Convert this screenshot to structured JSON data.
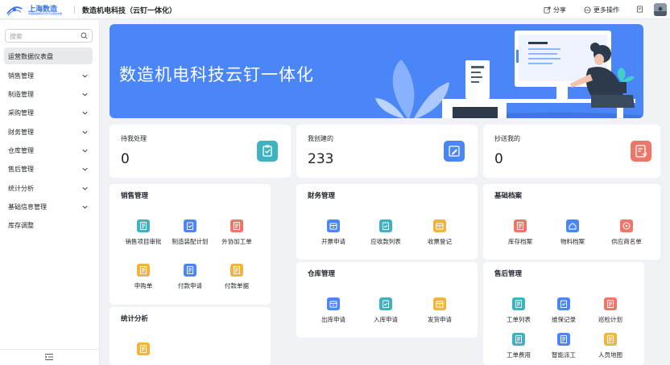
{
  "colors": {
    "blue": "#4a86f7",
    "teal": "#3fb2c2",
    "orange": "#f0b440",
    "red": "#ee7667",
    "banner": "#4a86f7"
  },
  "logo": {
    "name": "上海数造",
    "sub": "中國動機轉中化雲釘化數據產業",
    "icon": "logo-icon"
  },
  "app_title": "数造机电科技（云钉一体化）",
  "toolbar": {
    "share": "分享",
    "more": "更多操作"
  },
  "search": {
    "placeholder": "搜索"
  },
  "sidebar": {
    "items": [
      {
        "label": "运营数据仪表盘"
      },
      {
        "label": "销售管理"
      },
      {
        "label": "制造管理"
      },
      {
        "label": "采购管理"
      },
      {
        "label": "财务管理"
      },
      {
        "label": "仓库管理"
      },
      {
        "label": "售后管理"
      },
      {
        "label": "统计分析"
      },
      {
        "label": "基础信息管理"
      },
      {
        "label": "库存调整"
      }
    ]
  },
  "banner": {
    "title": "数造机电科技云钉一体化"
  },
  "stats": [
    {
      "label": "待我处理",
      "value": "0",
      "color": "#3fb2c2",
      "icon": "task-icon"
    },
    {
      "label": "我创建的",
      "value": "233",
      "color": "#4a86f7",
      "icon": "edit-icon"
    },
    {
      "label": "抄送我的",
      "value": "0",
      "color": "#ee7667",
      "icon": "cc-icon"
    }
  ],
  "cards": {
    "sales": {
      "title": "销售管理",
      "items": [
        {
          "label": "销售项目审批",
          "color": "#3fb2c2"
        },
        {
          "label": "制造装配计划",
          "color": "#4a86f7"
        },
        {
          "label": "外协加工单",
          "color": "#ee7667"
        },
        {
          "label": "申购单",
          "color": "#f0b440"
        },
        {
          "label": "付款申请",
          "color": "#4a86f7"
        },
        {
          "label": "付款单据",
          "color": "#f0b440"
        }
      ]
    },
    "finance": {
      "title": "财务管理",
      "items": [
        {
          "label": "开票申请",
          "color": "#4a86f7"
        },
        {
          "label": "应收款列表",
          "color": "#3fb2c2"
        },
        {
          "label": "收票登记",
          "color": "#f0b440"
        }
      ]
    },
    "basic": {
      "title": "基础档案",
      "items": [
        {
          "label": "库存档案",
          "color": "#ee7667"
        },
        {
          "label": "物料档案",
          "color": "#4a86f7"
        },
        {
          "label": "供应商名单",
          "color": "#ee7667"
        }
      ]
    },
    "warehouse": {
      "title": "仓库管理",
      "items": [
        {
          "label": "出库申请",
          "color": "#4a86f7"
        },
        {
          "label": "入库申请",
          "color": "#3fb2c2"
        },
        {
          "label": "发货申请",
          "color": "#f0b440"
        }
      ]
    },
    "aftersales": {
      "title": "售后管理",
      "items": [
        {
          "label": "工单列表",
          "color": "#3fb2c2"
        },
        {
          "label": "维保记录",
          "color": "#4a86f7"
        },
        {
          "label": "巡检计划",
          "color": "#ee7667"
        },
        {
          "label": "工单费用",
          "color": "#3fb2c2"
        },
        {
          "label": "智能派工",
          "color": "#4a86f7"
        },
        {
          "label": "人员地图",
          "color": "#f0b440"
        }
      ]
    },
    "stats": {
      "title": "统计分析",
      "items": [
        {
          "label": "",
          "color": "#f0b440"
        }
      ]
    }
  }
}
